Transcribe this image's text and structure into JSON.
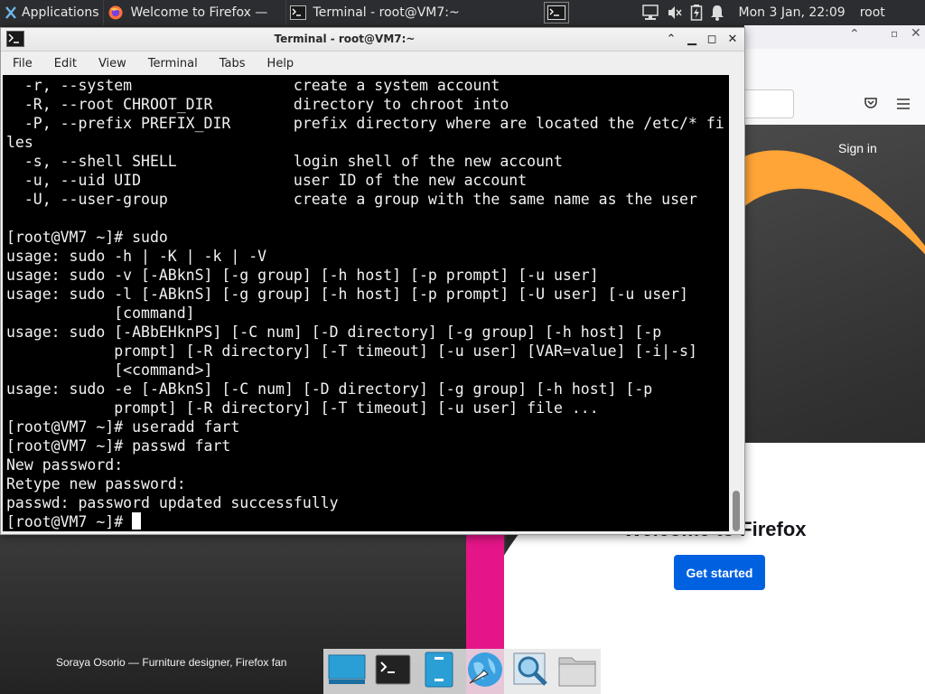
{
  "top_panel": {
    "applications_label": "Applications",
    "tasks": [
      {
        "label": "Welcome to Firefox —"
      },
      {
        "label": "Terminal - root@VM7:~"
      }
    ],
    "clock": "Mon   3 Jan, 22:09",
    "user": "root",
    "icons": [
      "applications-icon",
      "firefox-icon",
      "terminal-icon",
      "network-icon",
      "volume-icon",
      "battery-icon",
      "notification-bell-icon"
    ]
  },
  "terminal": {
    "title": "Terminal - root@VM7:~",
    "menu": [
      "File",
      "Edit",
      "View",
      "Terminal",
      "Tabs",
      "Help"
    ],
    "lines": [
      "  -r, --system                  create a system account",
      "  -R, --root CHROOT_DIR         directory to chroot into",
      "  -P, --prefix PREFIX_DIR       prefix directory where are located the /etc/* fi",
      "les",
      "  -s, --shell SHELL             login shell of the new account",
      "  -u, --uid UID                 user ID of the new account",
      "  -U, --user-group              create a group with the same name as the user",
      "",
      "[root@VM7 ~]# sudo",
      "usage: sudo -h | -K | -k | -V",
      "usage: sudo -v [-ABknS] [-g group] [-h host] [-p prompt] [-u user]",
      "usage: sudo -l [-ABknS] [-g group] [-h host] [-p prompt] [-U user] [-u user]",
      "            [command]",
      "usage: sudo [-ABbEHknPS] [-C num] [-D directory] [-g group] [-h host] [-p",
      "            prompt] [-R directory] [-T timeout] [-u user] [VAR=value] [-i|-s]",
      "            [<command>]",
      "usage: sudo -e [-ABknS] [-C num] [-D directory] [-g group] [-h host] [-p",
      "            prompt] [-R directory] [-T timeout] [-u user] file ...",
      "[root@VM7 ~]# useradd fart",
      "[root@VM7 ~]# passwd fart",
      "New password:",
      "Retype new password:",
      "passwd: password updated successfully"
    ],
    "prompt": "[root@VM7 ~]# "
  },
  "firefox": {
    "sign_in": "Sign in",
    "welcome": "Welcome to Firefox",
    "get_started": "Get started",
    "credit": "Soraya Osorio — Furniture designer, Firefox fan"
  },
  "dock": {
    "items": [
      "desktop-icon",
      "terminal-icon",
      "file-manager-icon",
      "browser-icon",
      "search-icon",
      "folder-icon"
    ]
  },
  "colors": {
    "panel_bg": "#2b2d30",
    "terminal_bg": "#000000",
    "terminal_fg": "#f2f2f2",
    "firefox_blue": "#0061e0"
  }
}
